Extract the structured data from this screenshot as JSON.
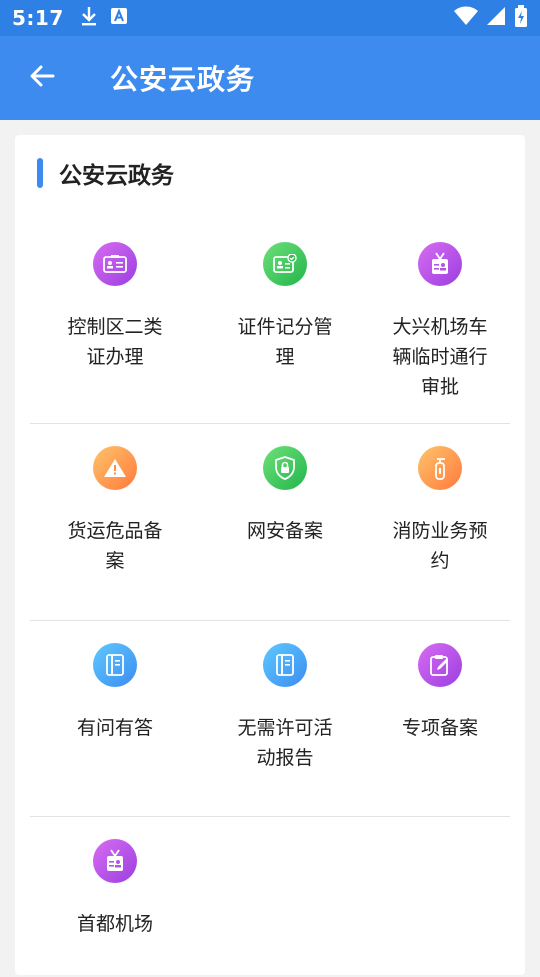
{
  "status_bar": {
    "time": "5:17",
    "icons": [
      "download-icon",
      "accessibility-icon",
      "wifi-icon",
      "signal-icon",
      "battery-charging-icon"
    ]
  },
  "app_bar": {
    "title": "公安云政务",
    "back_icon": "arrow-left-icon"
  },
  "section": {
    "title": "公安云政务",
    "accent_color": "#3e8bef"
  },
  "services": [
    {
      "label": "控制区二类证办理",
      "icon": "id-card-icon",
      "color": "purple"
    },
    {
      "label": "证件记分管理",
      "icon": "verified-card-icon",
      "color": "green"
    },
    {
      "label": "大兴机场车辆临时通行审批",
      "icon": "badge-icon",
      "color": "purple"
    },
    {
      "label": "货运危品备案",
      "icon": "warning-icon",
      "color": "orange"
    },
    {
      "label": "网安备案",
      "icon": "shield-lock-icon",
      "color": "green"
    },
    {
      "label": "消防业务预约",
      "icon": "fire-extinguisher-icon",
      "color": "orange"
    },
    {
      "label": "有问有答",
      "icon": "notebook-icon",
      "color": "blue"
    },
    {
      "label": "无需许可活动报告",
      "icon": "notebook-icon",
      "color": "blue"
    },
    {
      "label": "专项备案",
      "icon": "edit-clipboard-icon",
      "color": "purple"
    },
    {
      "label": "首都机场",
      "icon": "badge-icon",
      "color": "purple"
    }
  ],
  "colors": {
    "status_bar": "#2f80e4",
    "app_bar": "#3e8bef",
    "purple": "#b356e8",
    "green": "#3cc95e",
    "orange": "#ff9a4e",
    "blue": "#4aa8f6"
  }
}
